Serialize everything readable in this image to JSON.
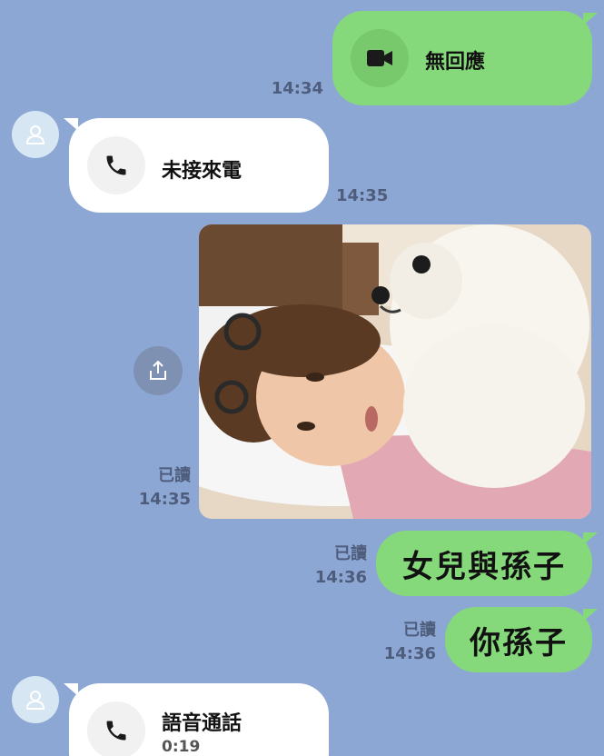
{
  "messages": {
    "video_call": {
      "label": "無回應",
      "time": "14:34",
      "icon": "video-camera-icon"
    },
    "missed_call": {
      "label": "未接來電",
      "time": "14:35",
      "icon": "phone-icon"
    },
    "photo": {
      "read": "已讀",
      "time": "14:35",
      "share_icon": "share-icon"
    },
    "text1": {
      "read": "已讀",
      "time": "14:36",
      "text": "女兒與孫子"
    },
    "text2": {
      "read": "已讀",
      "time": "14:36",
      "text": "你孫子"
    },
    "voice_call": {
      "label": "語音通話",
      "duration": "0:19",
      "icon": "phone-icon"
    }
  },
  "colors": {
    "background": "#8ca7d4",
    "outgoing_bubble": "#86d97a",
    "incoming_bubble": "#ffffff"
  }
}
